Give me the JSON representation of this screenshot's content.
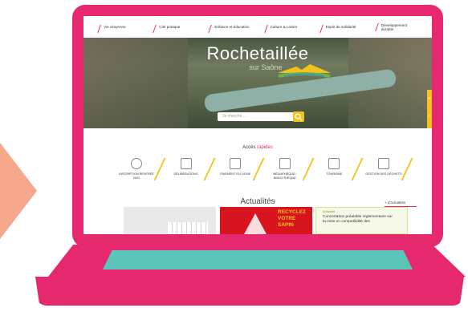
{
  "nav": {
    "items": [
      {
        "label": "Vie citoyenne"
      },
      {
        "label": "Cité pratique"
      },
      {
        "label": "Enfance et éducation"
      },
      {
        "label": "Culture & Loisirs"
      },
      {
        "label": "Esprit de solidarité"
      },
      {
        "label": "Développement durable"
      }
    ]
  },
  "hero": {
    "title": "Rochetaillée",
    "subtitle": "sur Saône",
    "search_placeholder": "Je cherche..."
  },
  "acces": {
    "label": "Accès",
    "highlight": "rapides"
  },
  "quick_links": [
    {
      "label": "INSCRIPTION RENTRÉE 2022",
      "icon": "school-icon"
    },
    {
      "label": "DÉLIBÉRATIONS",
      "icon": "document-icon"
    },
    {
      "label": "PAIEMENT EN LIGNE",
      "icon": "payment-icon"
    },
    {
      "label": "MÉDIATHÈQUE / BIBLIOTHÈQUE",
      "icon": "library-icon"
    },
    {
      "label": "TOURISME",
      "icon": "tourism-icon"
    },
    {
      "label": "GESTION DES DÉCHETS",
      "icon": "trash-icon"
    }
  ],
  "news": {
    "title": "Actualités",
    "all_link": "+ d'actualités",
    "cards": [
      {
        "title": ""
      },
      {
        "title": "RECYCLEZ VOTRE SAPIN"
      },
      {
        "tag": "Actualité",
        "title": "Concertation préalable réglementaire sur la mise en compatibilité des"
      }
    ]
  },
  "colors": {
    "brand": "#e6286f",
    "accent": "#f4c21a",
    "trackpad": "#5bc6b8",
    "arrow": "#f5a88c"
  }
}
